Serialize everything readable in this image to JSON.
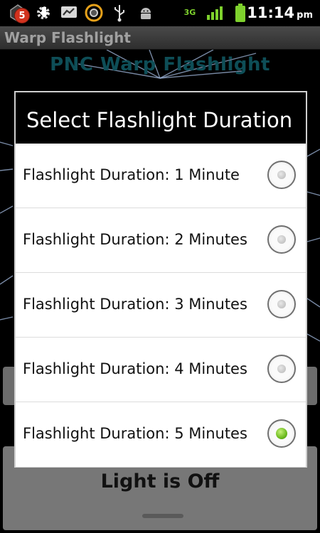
{
  "status_bar": {
    "notification_count": "5",
    "time": "11:14",
    "ampm": "pm",
    "network": "3G",
    "icons": [
      "notification-icon",
      "gear-icon",
      "download-icon",
      "messages-icon",
      "sync-icon",
      "usb-icon",
      "android-icon",
      "network-3g-icon",
      "signal-icon",
      "battery-icon"
    ]
  },
  "app": {
    "title": "Warp Flashlight",
    "heading": "PNC Warp Flashlight",
    "light_status": "Light is Off"
  },
  "dialog": {
    "title": "Select Flashlight Duration",
    "options": [
      {
        "label": "Flashlight Duration: 1 Minute",
        "selected": false
      },
      {
        "label": "Flashlight Duration: 2 Minutes",
        "selected": false
      },
      {
        "label": "Flashlight Duration: 3 Minutes",
        "selected": false
      },
      {
        "label": "Flashlight Duration: 4 Minutes",
        "selected": false
      },
      {
        "label": "Flashlight Duration: 5 Minutes",
        "selected": true
      }
    ]
  },
  "colors": {
    "heading": "#0e4e57",
    "radio_selected": "#6dbb1f",
    "warp_streaks": "#9fb6d9"
  }
}
